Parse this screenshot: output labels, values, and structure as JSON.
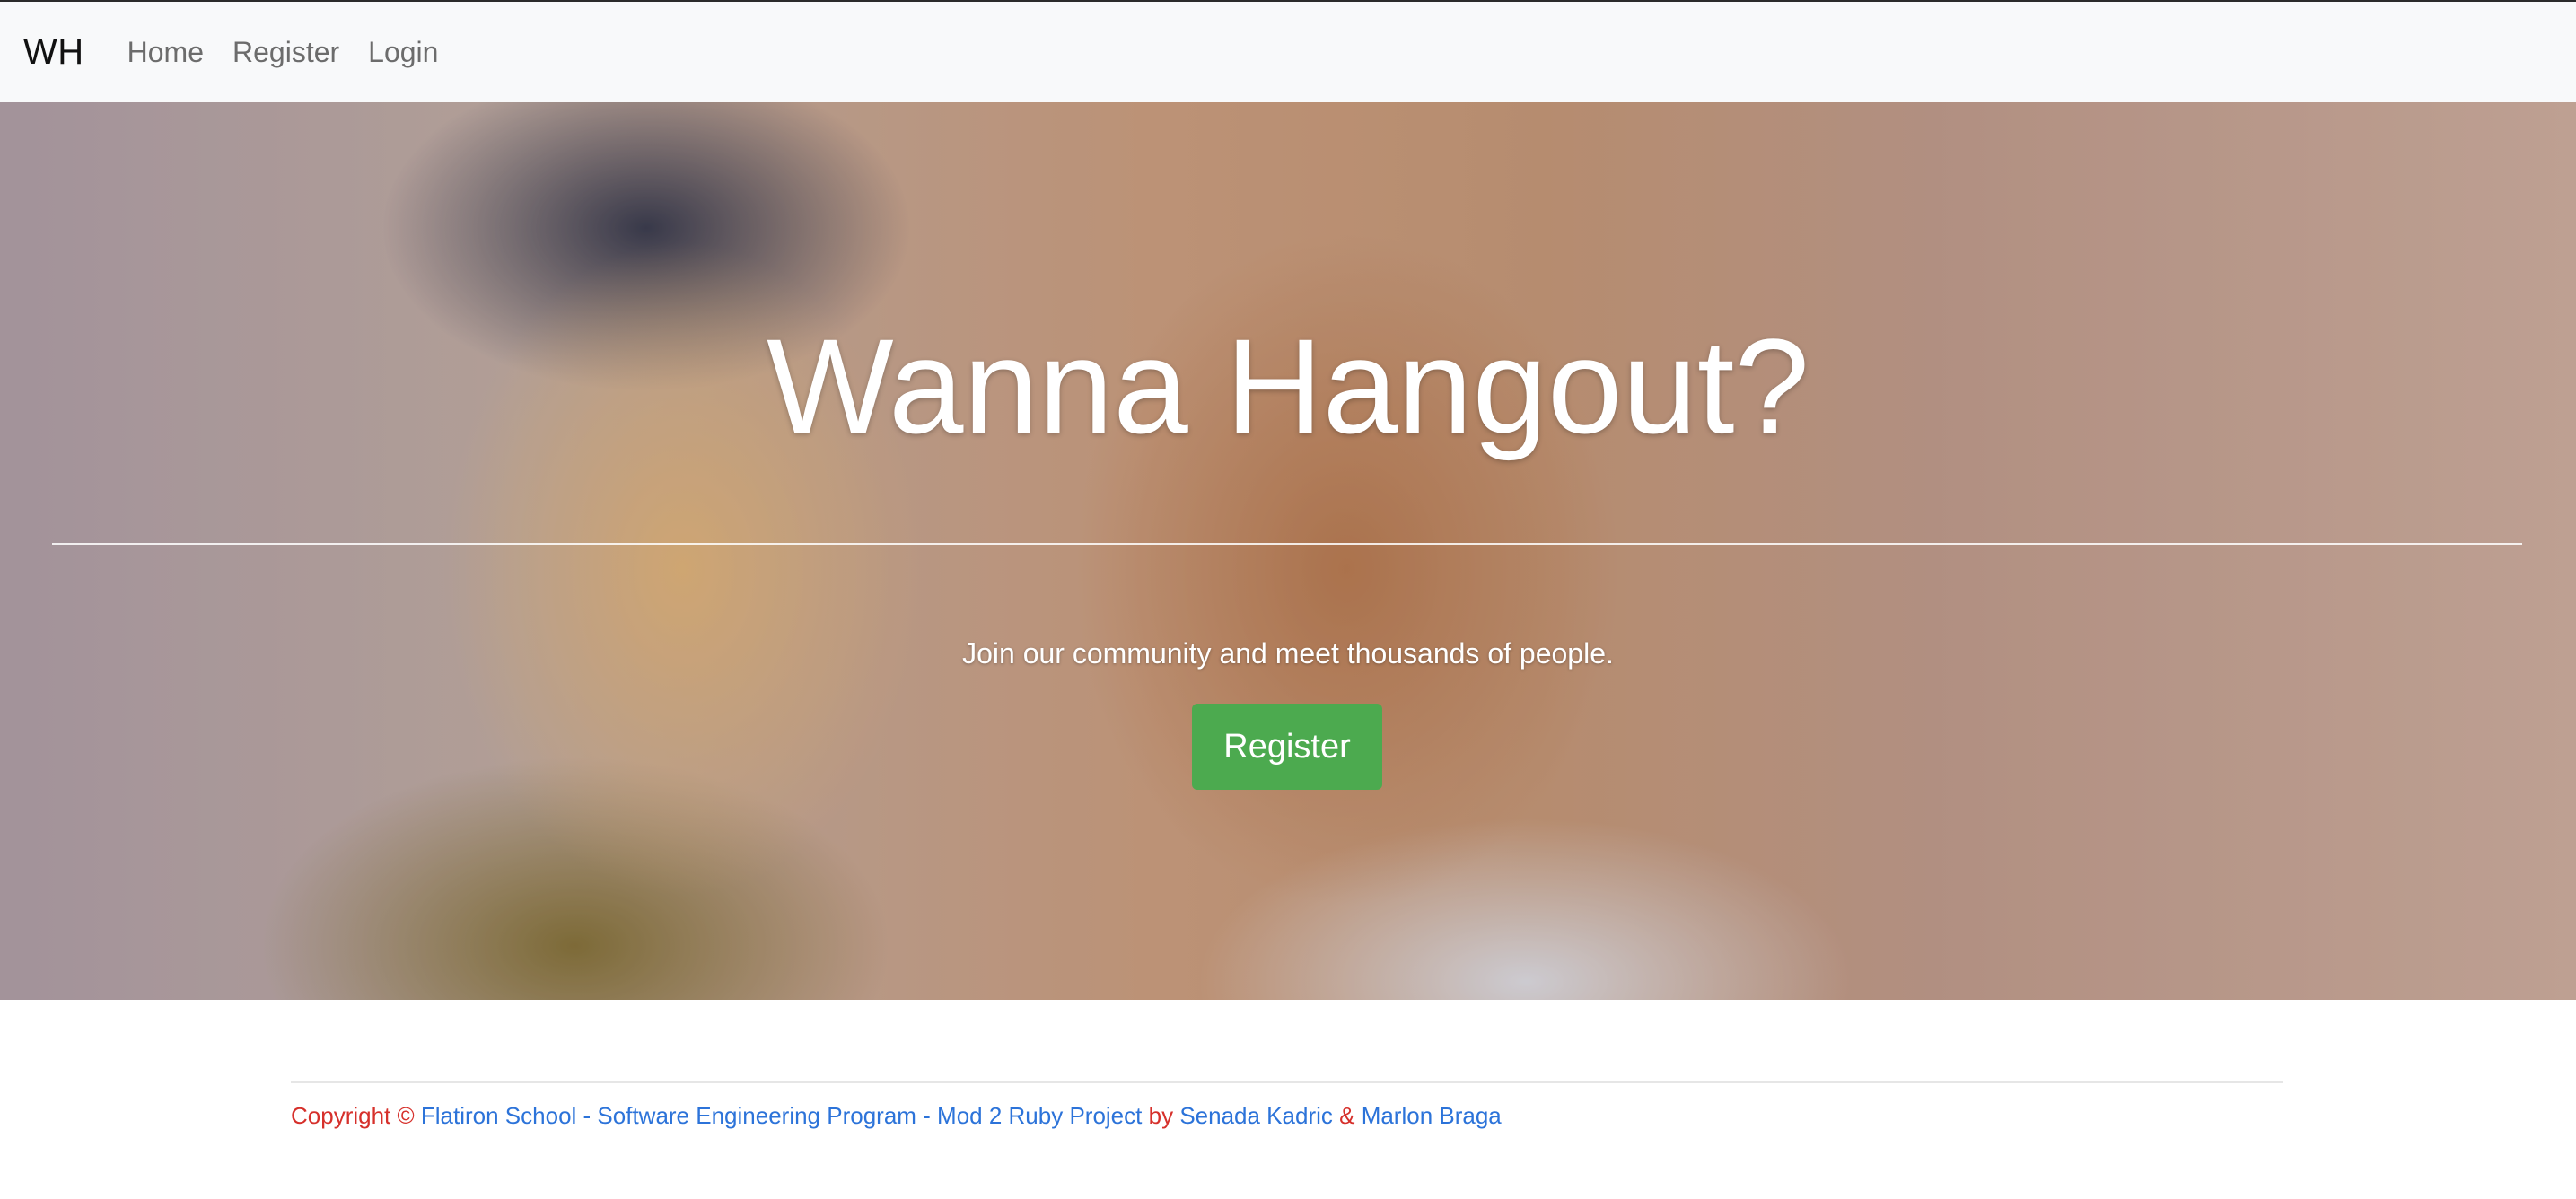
{
  "navbar": {
    "brand": "WH",
    "links": [
      "Home",
      "Register",
      "Login"
    ]
  },
  "hero": {
    "title": "Wanna Hangout?",
    "subtitle": "Join our community and meet thousands of people.",
    "register_label": "Register"
  },
  "footer": {
    "copyright": "Copyright ©",
    "program_link": "Flatiron School - Software Engineering Program - Mod 2 Ruby Project",
    "by": "by",
    "author1": "Senada Kadric",
    "amp": "&",
    "author2": "Marlon Braga"
  },
  "colors": {
    "brand_green": "#4caa4f",
    "footer_red": "#d6302b",
    "link_blue": "#2c73d9",
    "navbar_bg": "#f8f9fa"
  }
}
